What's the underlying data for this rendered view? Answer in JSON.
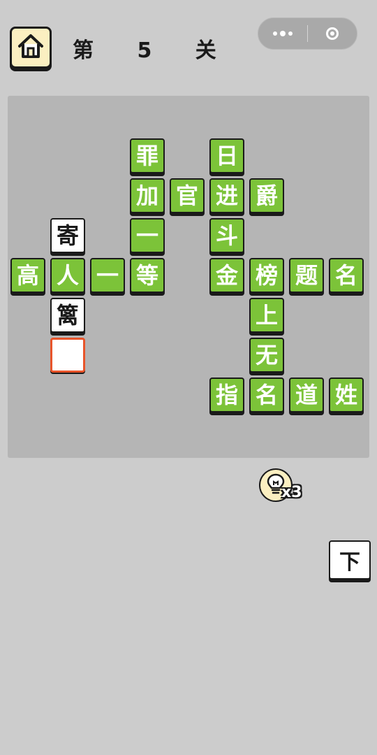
{
  "header": {
    "level_title": "第 5 关"
  },
  "board": {
    "tiles": [
      {
        "char": "罪",
        "style": "green"
      },
      {
        "char": "日",
        "style": "green"
      },
      {
        "char": "加",
        "style": "green"
      },
      {
        "char": "官",
        "style": "green"
      },
      {
        "char": "进",
        "style": "green"
      },
      {
        "char": "爵",
        "style": "green"
      },
      {
        "char": "寄",
        "style": "white"
      },
      {
        "char": "一",
        "style": "green"
      },
      {
        "char": "斗",
        "style": "green"
      },
      {
        "char": "高",
        "style": "green"
      },
      {
        "char": "人",
        "style": "green"
      },
      {
        "char": "一",
        "style": "green"
      },
      {
        "char": "等",
        "style": "green"
      },
      {
        "char": "金",
        "style": "green"
      },
      {
        "char": "榜",
        "style": "green"
      },
      {
        "char": "题",
        "style": "green"
      },
      {
        "char": "名",
        "style": "green"
      },
      {
        "char": "篱",
        "style": "white"
      },
      {
        "char": "上",
        "style": "green"
      },
      {
        "char": "",
        "style": "empty"
      },
      {
        "char": "无",
        "style": "green"
      },
      {
        "char": "指",
        "style": "green"
      },
      {
        "char": "名",
        "style": "green"
      },
      {
        "char": "道",
        "style": "green"
      },
      {
        "char": "姓",
        "style": "green"
      }
    ]
  },
  "hint": {
    "count_label": "x3"
  },
  "next_button": {
    "label": "下"
  },
  "colors": {
    "background": "#cccccc",
    "board": "#b5b5b5",
    "tile_green": "#7cc339",
    "tile_white": "#ffffff",
    "selected_border": "#e8542a",
    "home_button": "#fbefc1"
  }
}
